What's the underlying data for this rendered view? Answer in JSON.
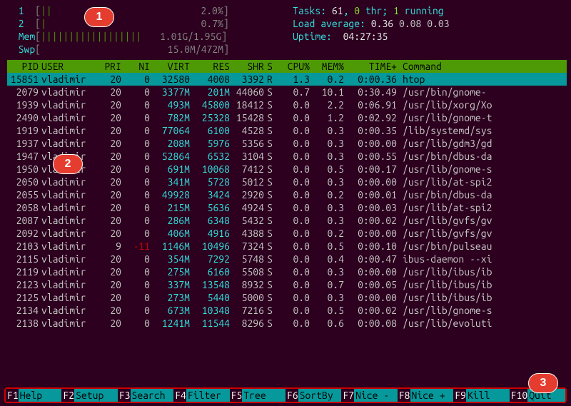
{
  "header": {
    "cpu": [
      {
        "id": "1",
        "bar": "||",
        "pct": "2.0%"
      },
      {
        "id": "2",
        "bar": "|",
        "pct": "0.7%"
      }
    ],
    "mem": {
      "label": "Mem",
      "bar": "||||||||||||||||||",
      "text": "1.01G/1.95G"
    },
    "swp": {
      "label": "Swp",
      "bar": "",
      "text": "15.0M/472M"
    },
    "tasks": {
      "label": "Tasks:",
      "total": "61",
      "thr": "0",
      "running": "1",
      "suffix": " thr; ",
      "run_suffix": " running"
    },
    "load": {
      "label": "Load average:",
      "v1": "0.36",
      "v2": "0.08",
      "v3": "0.03"
    },
    "uptime": {
      "label": "Uptime:",
      "value": "04:27:35"
    }
  },
  "cols": [
    "PID",
    "USER",
    "PRI",
    "NI",
    "VIRT",
    "RES",
    "SHR",
    "S",
    "CPU%",
    "MEM%",
    "TIME+",
    "Command"
  ],
  "rows": [
    {
      "pid": "15851",
      "user": "vladimir",
      "pri": "20",
      "ni": "0",
      "virt": "32580",
      "res": "4008",
      "shr": "3392",
      "s": "R",
      "cpu": "1.3",
      "mem": "0.2",
      "time": "0:00.36",
      "cmd": "htop",
      "sel": true
    },
    {
      "pid": "2079",
      "user": "vladimir",
      "pri": "20",
      "ni": "0",
      "virt": "3377M",
      "res": "201M",
      "shr": "44060",
      "s": "S",
      "cpu": "0.7",
      "mem": "10.1",
      "time": "0:30.49",
      "cmd": "/usr/bin/gnome-"
    },
    {
      "pid": "1939",
      "user": "vladimir",
      "pri": "20",
      "ni": "0",
      "virt": "493M",
      "res": "45800",
      "shr": "18412",
      "s": "S",
      "cpu": "0.0",
      "mem": "2.2",
      "time": "0:06.91",
      "cmd": "/usr/lib/xorg/Xo"
    },
    {
      "pid": "2490",
      "user": "vladimir",
      "pri": "20",
      "ni": "0",
      "virt": "782M",
      "res": "25328",
      "shr": "15428",
      "s": "S",
      "cpu": "0.0",
      "mem": "1.2",
      "time": "0:02.92",
      "cmd": "/usr/lib/gnome-t"
    },
    {
      "pid": "1919",
      "user": "vladimir",
      "pri": "20",
      "ni": "0",
      "virt": "77064",
      "res": "6100",
      "shr": "4528",
      "s": "S",
      "cpu": "0.0",
      "mem": "0.3",
      "time": "0:00.35",
      "cmd": "/lib/systemd/sys"
    },
    {
      "pid": "1937",
      "user": "vladimir",
      "pri": "20",
      "ni": "0",
      "virt": "208M",
      "res": "5976",
      "shr": "5356",
      "s": "S",
      "cpu": "0.0",
      "mem": "0.3",
      "time": "0:00.00",
      "cmd": "/usr/lib/gdm3/gd"
    },
    {
      "pid": "1947",
      "user": "vladimir",
      "pri": "20",
      "ni": "0",
      "virt": "52864",
      "res": "6532",
      "shr": "3104",
      "s": "S",
      "cpu": "0.0",
      "mem": "0.3",
      "time": "0:00.55",
      "cmd": "/usr/bin/dbus-da"
    },
    {
      "pid": "1950",
      "user": "vladimir",
      "pri": "20",
      "ni": "0",
      "virt": "691M",
      "res": "10068",
      "shr": "7412",
      "s": "S",
      "cpu": "0.0",
      "mem": "0.5",
      "time": "0:00.17",
      "cmd": "/usr/lib/gnome-s"
    },
    {
      "pid": "2050",
      "user": "vladimir",
      "pri": "20",
      "ni": "0",
      "virt": "341M",
      "res": "5728",
      "shr": "5012",
      "s": "S",
      "cpu": "0.0",
      "mem": "0.3",
      "time": "0:00.00",
      "cmd": "/usr/lib/at-spi2"
    },
    {
      "pid": "2055",
      "user": "vladimir",
      "pri": "20",
      "ni": "0",
      "virt": "49928",
      "res": "3424",
      "shr": "2920",
      "s": "S",
      "cpu": "0.0",
      "mem": "0.2",
      "time": "0:00.01",
      "cmd": "/usr/bin/dbus-da"
    },
    {
      "pid": "2058",
      "user": "vladimir",
      "pri": "20",
      "ni": "0",
      "virt": "215M",
      "res": "5636",
      "shr": "4924",
      "s": "S",
      "cpu": "0.0",
      "mem": "0.3",
      "time": "0:00.03",
      "cmd": "/usr/lib/at-spi2"
    },
    {
      "pid": "2087",
      "user": "vladimir",
      "pri": "20",
      "ni": "0",
      "virt": "286M",
      "res": "6348",
      "shr": "5432",
      "s": "S",
      "cpu": "0.0",
      "mem": "0.3",
      "time": "0:00.02",
      "cmd": "/usr/lib/gvfs/gv"
    },
    {
      "pid": "2092",
      "user": "vladimir",
      "pri": "20",
      "ni": "0",
      "virt": "406M",
      "res": "4916",
      "shr": "4388",
      "s": "S",
      "cpu": "0.0",
      "mem": "0.2",
      "time": "0:00.00",
      "cmd": "/usr/lib/gvfs/gv"
    },
    {
      "pid": "2103",
      "user": "vladimir",
      "pri": "9",
      "ni": "-11",
      "virt": "1146M",
      "res": "10496",
      "shr": "7324",
      "s": "S",
      "cpu": "0.0",
      "mem": "0.5",
      "time": "0:00.10",
      "cmd": "/usr/bin/pulseau"
    },
    {
      "pid": "2115",
      "user": "vladimir",
      "pri": "20",
      "ni": "0",
      "virt": "354M",
      "res": "7292",
      "shr": "5748",
      "s": "S",
      "cpu": "0.0",
      "mem": "0.4",
      "time": "0:00.47",
      "cmd": "ibus-daemon --xi"
    },
    {
      "pid": "2119",
      "user": "vladimir",
      "pri": "20",
      "ni": "0",
      "virt": "275M",
      "res": "6160",
      "shr": "5508",
      "s": "S",
      "cpu": "0.0",
      "mem": "0.3",
      "time": "0:00.00",
      "cmd": "/usr/lib/ibus/ib"
    },
    {
      "pid": "2123",
      "user": "vladimir",
      "pri": "20",
      "ni": "0",
      "virt": "337M",
      "res": "13548",
      "shr": "8932",
      "s": "S",
      "cpu": "0.0",
      "mem": "0.7",
      "time": "0:00.05",
      "cmd": "/usr/lib/ibus/ib"
    },
    {
      "pid": "2125",
      "user": "vladimir",
      "pri": "20",
      "ni": "0",
      "virt": "273M",
      "res": "5440",
      "shr": "5000",
      "s": "S",
      "cpu": "0.0",
      "mem": "0.3",
      "time": "0:00.00",
      "cmd": "/usr/lib/ibus/ib"
    },
    {
      "pid": "2134",
      "user": "vladimir",
      "pri": "20",
      "ni": "0",
      "virt": "673M",
      "res": "10348",
      "shr": "7216",
      "s": "S",
      "cpu": "0.0",
      "mem": "0.5",
      "time": "0:00.02",
      "cmd": "/usr/lib/gnome-s"
    },
    {
      "pid": "2138",
      "user": "vladimir",
      "pri": "20",
      "ni": "0",
      "virt": "1241M",
      "res": "11544",
      "shr": "8296",
      "s": "S",
      "cpu": "0.0",
      "mem": "0.6",
      "time": "0:00.08",
      "cmd": "/usr/lib/evoluti"
    }
  ],
  "footer": [
    {
      "key": "F1",
      "label": "Help"
    },
    {
      "key": "F2",
      "label": "Setup"
    },
    {
      "key": "F3",
      "label": "Search"
    },
    {
      "key": "F4",
      "label": "Filter"
    },
    {
      "key": "F5",
      "label": "Tree"
    },
    {
      "key": "F6",
      "label": "SortBy"
    },
    {
      "key": "F7",
      "label": "Nice -"
    },
    {
      "key": "F8",
      "label": "Nice +"
    },
    {
      "key": "F9",
      "label": "Kill"
    },
    {
      "key": "F10",
      "label": "Quit"
    }
  ],
  "callouts": {
    "1": "1",
    "2": "2",
    "3": "3"
  }
}
